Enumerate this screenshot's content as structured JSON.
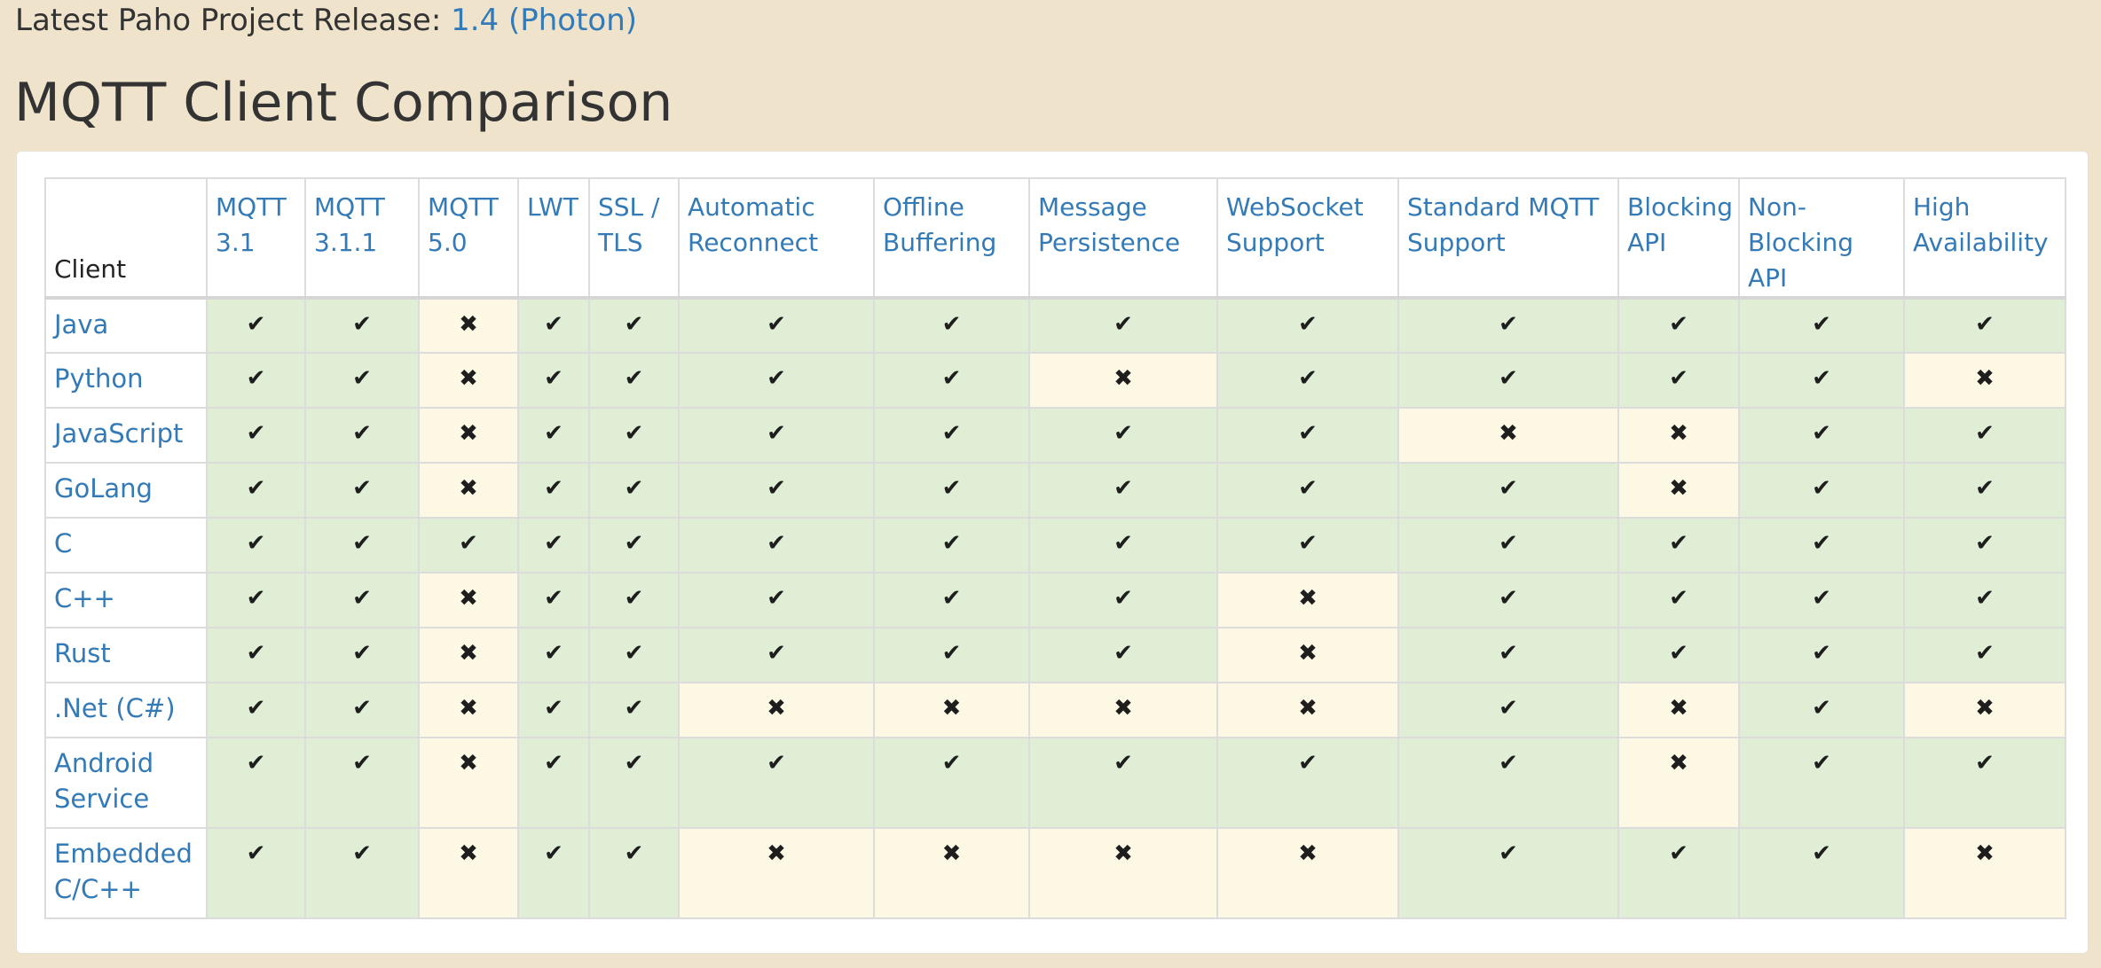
{
  "release": {
    "label": "Latest Paho Project Release: ",
    "version": "1.4 (Photon)"
  },
  "page_title": "MQTT Client Comparison",
  "icons": {
    "check": "✔",
    "cross": "✖"
  },
  "colors": {
    "supported_bg": "#dfeed5",
    "unsupported_bg": "#fcf8e3",
    "link": "#337ab7",
    "page_bg": "#efe4cb"
  },
  "table": {
    "client_header": "Client",
    "columns": [
      "MQTT 3.1",
      "MQTT 3.1.1",
      "MQTT 5.0",
      "LWT",
      "SSL / TLS",
      "Automatic Reconnect",
      "Offline Buffering",
      "Message Persistence",
      "WebSocket Support",
      "Standard MQTT Support",
      "Blocking API",
      "Non-Blocking API",
      "High Availability"
    ],
    "rows": [
      {
        "client": "Java",
        "support": [
          true,
          true,
          false,
          true,
          true,
          true,
          true,
          true,
          true,
          true,
          true,
          true,
          true
        ]
      },
      {
        "client": "Python",
        "support": [
          true,
          true,
          false,
          true,
          true,
          true,
          true,
          false,
          true,
          true,
          true,
          true,
          false
        ]
      },
      {
        "client": "JavaScript",
        "support": [
          true,
          true,
          false,
          true,
          true,
          true,
          true,
          true,
          true,
          false,
          false,
          true,
          true
        ]
      },
      {
        "client": "GoLang",
        "support": [
          true,
          true,
          false,
          true,
          true,
          true,
          true,
          true,
          true,
          true,
          false,
          true,
          true
        ]
      },
      {
        "client": "C",
        "support": [
          true,
          true,
          true,
          true,
          true,
          true,
          true,
          true,
          true,
          true,
          true,
          true,
          true
        ]
      },
      {
        "client": "C++",
        "support": [
          true,
          true,
          false,
          true,
          true,
          true,
          true,
          true,
          false,
          true,
          true,
          true,
          true
        ]
      },
      {
        "client": "Rust",
        "support": [
          true,
          true,
          false,
          true,
          true,
          true,
          true,
          true,
          false,
          true,
          true,
          true,
          true
        ]
      },
      {
        "client": ".Net (C#)",
        "support": [
          true,
          true,
          false,
          true,
          true,
          false,
          false,
          false,
          false,
          true,
          false,
          true,
          false
        ]
      },
      {
        "client": "Android Service",
        "support": [
          true,
          true,
          false,
          true,
          true,
          true,
          true,
          true,
          true,
          true,
          false,
          true,
          true
        ]
      },
      {
        "client": "Embedded C/C++",
        "support": [
          true,
          true,
          false,
          true,
          true,
          false,
          false,
          false,
          false,
          true,
          true,
          true,
          false
        ]
      }
    ]
  }
}
